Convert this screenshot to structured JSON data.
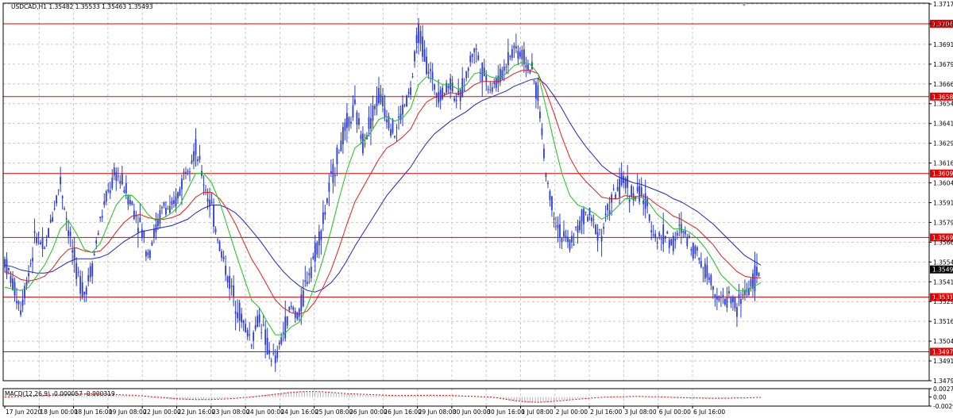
{
  "header": {
    "title": "USDCAD,H1  1.35482 1.35533 1.35463 1.35493",
    "macd_label": "MACD(12,26,9) -0.000057 -0.000319"
  },
  "colors": {
    "background": "#ffffff",
    "grid": "#c8c8c8",
    "candle": "#2b3bdb",
    "line_fast": "#18c418",
    "line_mid": "#e31c1c",
    "line_slow": "#2323c8",
    "level": "#e60000",
    "macd_signal": "#e60000",
    "macd_hist": "#b4b4b4",
    "axis_text": "#000000"
  },
  "chart_data": [
    {
      "type": "line",
      "title": "USDCAD,H1",
      "ylim": [
        1.3479,
        1.37175
      ],
      "price_ticks": [
        "1.37170",
        "1.37045",
        "1.36915",
        "1.36790",
        "1.36665",
        "1.36540",
        "1.36415",
        "1.36290",
        "1.36165",
        "1.36040",
        "1.35915",
        "1.35790",
        "1.35665",
        "1.35540",
        "1.35415",
        "1.35290",
        "1.35165",
        "1.35040",
        "1.34915",
        "1.34790"
      ],
      "levels": [
        {
          "label": "1.37045",
          "value": 1.37045
        },
        {
          "label": "1.36585",
          "value": 1.36585
        },
        {
          "label": "1.36099",
          "value": 1.36099
        },
        {
          "label": "1.35695",
          "value": 1.35695
        },
        {
          "label": "1.35318",
          "value": 1.35318
        },
        {
          "label": "1.34973",
          "value": 1.34973
        }
      ],
      "current_price": {
        "label": "1.35493",
        "value": 1.35493
      },
      "time_ticks": [
        "17 Jun 2020",
        "18 Jun 00:00",
        "18 Jun 16:00",
        "19 Jun 08:00",
        "22 Jun 00:00",
        "22 Jun 16:00",
        "23 Jun 08:00",
        "24 Jun 00:00",
        "24 Jun 16:00",
        "25 Jun 08:00",
        "26 Jun 00:00",
        "26 Jun 16:00",
        "29 Jun 08:00",
        "30 Jun 00:00",
        "30 Jun 16:00",
        "1 Jul 08:00",
        "2 Jul 00:00",
        "2 Jul 16:00",
        "3 Jul 08:00",
        "6 Jul 00:00",
        "6 Jul 16:00"
      ],
      "price_series": [
        1.3555,
        1.354,
        1.3525,
        1.3548,
        1.3572,
        1.356,
        1.3585,
        1.3605,
        1.3575,
        1.3548,
        1.3535,
        1.3552,
        1.358,
        1.3598,
        1.361,
        1.3602,
        1.359,
        1.3578,
        1.356,
        1.3575,
        1.359,
        1.3585,
        1.36,
        1.3618,
        1.3625,
        1.3605,
        1.3588,
        1.3565,
        1.3545,
        1.353,
        1.3515,
        1.3505,
        1.352,
        1.35,
        1.349,
        1.351,
        1.3525,
        1.352,
        1.3545,
        1.356,
        1.358,
        1.3605,
        1.3625,
        1.364,
        1.365,
        1.363,
        1.3645,
        1.366,
        1.3648,
        1.3635,
        1.365,
        1.3662,
        1.37,
        1.368,
        1.3665,
        1.366,
        1.3668,
        1.3655,
        1.3672,
        1.369,
        1.3675,
        1.3665,
        1.3668,
        1.368,
        1.369,
        1.3685,
        1.3676,
        1.366,
        1.361,
        1.3585,
        1.357,
        1.3565,
        1.3575,
        1.3585,
        1.3578,
        1.3572,
        1.359,
        1.36,
        1.3605,
        1.3595,
        1.3598,
        1.3582,
        1.3568,
        1.3572,
        1.3565,
        1.3575,
        1.3568,
        1.356,
        1.355,
        1.354,
        1.3528,
        1.3532,
        1.3525,
        1.3535,
        1.3542,
        1.3549
      ],
      "ma_fast": [
        1.3538,
        1.3537,
        1.3536,
        1.3538,
        1.3545,
        1.3552,
        1.3562,
        1.3575,
        1.358,
        1.3572,
        1.3562,
        1.356,
        1.3566,
        1.3578,
        1.359,
        1.3596,
        1.3596,
        1.3591,
        1.3584,
        1.358,
        1.3582,
        1.3585,
        1.359,
        1.36,
        1.361,
        1.361,
        1.3604,
        1.3592,
        1.3576,
        1.356,
        1.3545,
        1.353,
        1.3525,
        1.3516,
        1.3508,
        1.3508,
        1.3513,
        1.3516,
        1.3526,
        1.354,
        1.3556,
        1.3574,
        1.3594,
        1.3612,
        1.3626,
        1.363,
        1.3636,
        1.3644,
        1.3646,
        1.3643,
        1.3645,
        1.3651,
        1.3666,
        1.3671,
        1.3669,
        1.3666,
        1.3666,
        1.3663,
        1.3666,
        1.3673,
        1.3674,
        1.3671,
        1.367,
        1.3673,
        1.3678,
        1.368,
        1.3679,
        1.3673,
        1.3652,
        1.363,
        1.361,
        1.3596,
        1.359,
        1.3588,
        1.3585,
        1.3581,
        1.3584,
        1.3589,
        1.3594,
        1.3594,
        1.3595,
        1.3591,
        1.3584,
        1.358,
        1.3575,
        1.3575,
        1.3573,
        1.3569,
        1.3563,
        1.3555,
        1.3546,
        1.3541,
        1.3536,
        1.3536,
        1.3538,
        1.3541
      ],
      "ma_mid": [
        1.3548,
        1.3546,
        1.3543,
        1.3542,
        1.3543,
        1.3545,
        1.355,
        1.3557,
        1.3562,
        1.3563,
        1.3561,
        1.356,
        1.3561,
        1.3566,
        1.3573,
        1.3579,
        1.3583,
        1.3584,
        1.3582,
        1.3581,
        1.3581,
        1.3582,
        1.3584,
        1.3589,
        1.3595,
        1.3598,
        1.3598,
        1.3594,
        1.3587,
        1.3578,
        1.3567,
        1.3556,
        1.3548,
        1.3539,
        1.353,
        1.3525,
        1.3522,
        1.3521,
        1.3523,
        1.3529,
        1.3538,
        1.3549,
        1.3563,
        1.3578,
        1.3592,
        1.3601,
        1.361,
        1.3619,
        1.3626,
        1.3629,
        1.3633,
        1.3638,
        1.3648,
        1.3655,
        1.3658,
        1.3659,
        1.3661,
        1.366,
        1.3662,
        1.3666,
        1.3668,
        1.3668,
        1.3668,
        1.367,
        1.3673,
        1.3675,
        1.3675,
        1.3673,
        1.3662,
        1.3648,
        1.3633,
        1.362,
        1.3611,
        1.3605,
        1.36,
        1.3595,
        1.3594,
        1.3594,
        1.3596,
        1.3595,
        1.3596,
        1.3594,
        1.359,
        1.3587,
        1.3583,
        1.3581,
        1.3578,
        1.3575,
        1.357,
        1.3565,
        1.3558,
        1.3553,
        1.3548,
        1.3545,
        1.3544,
        1.3544
      ],
      "ma_slow": [
        1.3552,
        1.3551,
        1.3549,
        1.3548,
        1.3547,
        1.3547,
        1.3548,
        1.3551,
        1.3554,
        1.3556,
        1.3556,
        1.3556,
        1.3557,
        1.3559,
        1.3563,
        1.3567,
        1.357,
        1.3573,
        1.3574,
        1.3575,
        1.3576,
        1.3577,
        1.3579,
        1.3581,
        1.3585,
        1.3588,
        1.359,
        1.359,
        1.3588,
        1.3585,
        1.358,
        1.3574,
        1.3568,
        1.3561,
        1.3554,
        1.3548,
        1.3543,
        1.3539,
        1.3536,
        1.3535,
        1.3537,
        1.3541,
        1.3547,
        1.3555,
        1.3564,
        1.3572,
        1.358,
        1.3588,
        1.3596,
        1.3602,
        1.3608,
        1.3614,
        1.3622,
        1.3629,
        1.3635,
        1.3639,
        1.3643,
        1.3646,
        1.3649,
        1.3653,
        1.3656,
        1.3658,
        1.366,
        1.3662,
        1.3665,
        1.3667,
        1.3669,
        1.367,
        1.3666,
        1.3659,
        1.3651,
        1.3642,
        1.3634,
        1.3627,
        1.3621,
        1.3615,
        1.3611,
        1.3608,
        1.3606,
        1.3604,
        1.3603,
        1.3601,
        1.3599,
        1.3597,
        1.3594,
        1.3592,
        1.3589,
        1.3586,
        1.3582,
        1.3578,
        1.3573,
        1.3568,
        1.3563,
        1.3558,
        1.3555,
        1.3552
      ]
    },
    {
      "type": "bar",
      "title": "MACD(12,26,9)",
      "ylim": [
        -0.00295,
        0.00273
      ],
      "ticks": [
        {
          "label": "0.002736",
          "value": 0.00273
        },
        {
          "label": "0.00",
          "value": 0.0
        },
        {
          "label": "-0.00295",
          "value": -0.00295
        }
      ],
      "histogram": [
        0.0002,
        0.0003,
        0.0004,
        0.0005,
        0.0006,
        0.0007,
        0.0008,
        0.0009,
        0.001,
        0.0011,
        0.0011,
        0.001,
        0.0009,
        0.0008,
        0.0007,
        0.0006,
        0.0003,
        0.0001,
        -0.0002,
        -0.0004,
        -0.0006,
        -0.0008,
        -0.0009,
        -0.001,
        -0.001,
        -0.0009,
        -0.0008,
        -0.0006,
        -0.0004,
        -0.0002,
        0.0001,
        0.0003,
        0.0006,
        0.0009,
        0.0012,
        0.0015,
        0.0017,
        0.0018,
        0.0018,
        0.0017,
        0.0015,
        0.0013,
        0.0011,
        0.0009,
        0.0008,
        0.0007,
        0.0006,
        0.0005,
        0.0005,
        0.0004,
        0.0004,
        0.0005,
        0.0005,
        0.0006,
        0.0006,
        0.0005,
        0.0004,
        0.0003,
        0.0002,
        0.0002,
        0.0001,
        0.0,
        -0.0004,
        -0.001,
        -0.0015,
        -0.0018,
        -0.0019,
        -0.0018,
        -0.0016,
        -0.0013,
        -0.001,
        -0.0008,
        -0.0005,
        -0.0003,
        -0.0001,
        0.0,
        0.0001,
        0.0001,
        0.0002,
        0.0002,
        0.0001,
        0.0001,
        0.0,
        -0.0001,
        -0.0002,
        -0.0003,
        -0.0004,
        -0.0004,
        -0.0005,
        -0.0005,
        -0.0004,
        -0.0004,
        -0.0003,
        -0.0002,
        -0.0001,
        -0.0001
      ],
      "signal": [
        0.0,
        0.0001,
        0.0002,
        0.0003,
        0.0004,
        0.0005,
        0.0006,
        0.0007,
        0.0008,
        0.0009,
        0.001,
        0.001,
        0.001,
        0.0009,
        0.0008,
        0.0007,
        0.0006,
        0.0004,
        0.0002,
        0.0,
        -0.0002,
        -0.0004,
        -0.0006,
        -0.0007,
        -0.0008,
        -0.0008,
        -0.0008,
        -0.0007,
        -0.0006,
        -0.0004,
        -0.0002,
        0.0,
        0.0003,
        0.0006,
        0.0009,
        0.0012,
        0.0015,
        0.0017,
        0.0018,
        0.0018,
        0.0017,
        0.0015,
        0.0013,
        0.0011,
        0.001,
        0.0009,
        0.0008,
        0.0007,
        0.0006,
        0.0005,
        0.0005,
        0.0005,
        0.0005,
        0.0006,
        0.0006,
        0.0005,
        0.0005,
        0.0004,
        0.0003,
        0.0002,
        0.0001,
        0.0,
        -0.0003,
        -0.0007,
        -0.0011,
        -0.0014,
        -0.0016,
        -0.0017,
        -0.0016,
        -0.0014,
        -0.0012,
        -0.0009,
        -0.0007,
        -0.0005,
        -0.0003,
        -0.0001,
        0.0,
        0.0001,
        0.0001,
        0.0002,
        0.0002,
        0.0001,
        0.0001,
        0.0,
        -0.0001,
        -0.0002,
        -0.0003,
        -0.0003,
        -0.0004,
        -0.0004,
        -0.0004,
        -0.0004,
        -0.0003,
        -0.0003,
        -0.0002,
        -0.0001
      ]
    }
  ]
}
